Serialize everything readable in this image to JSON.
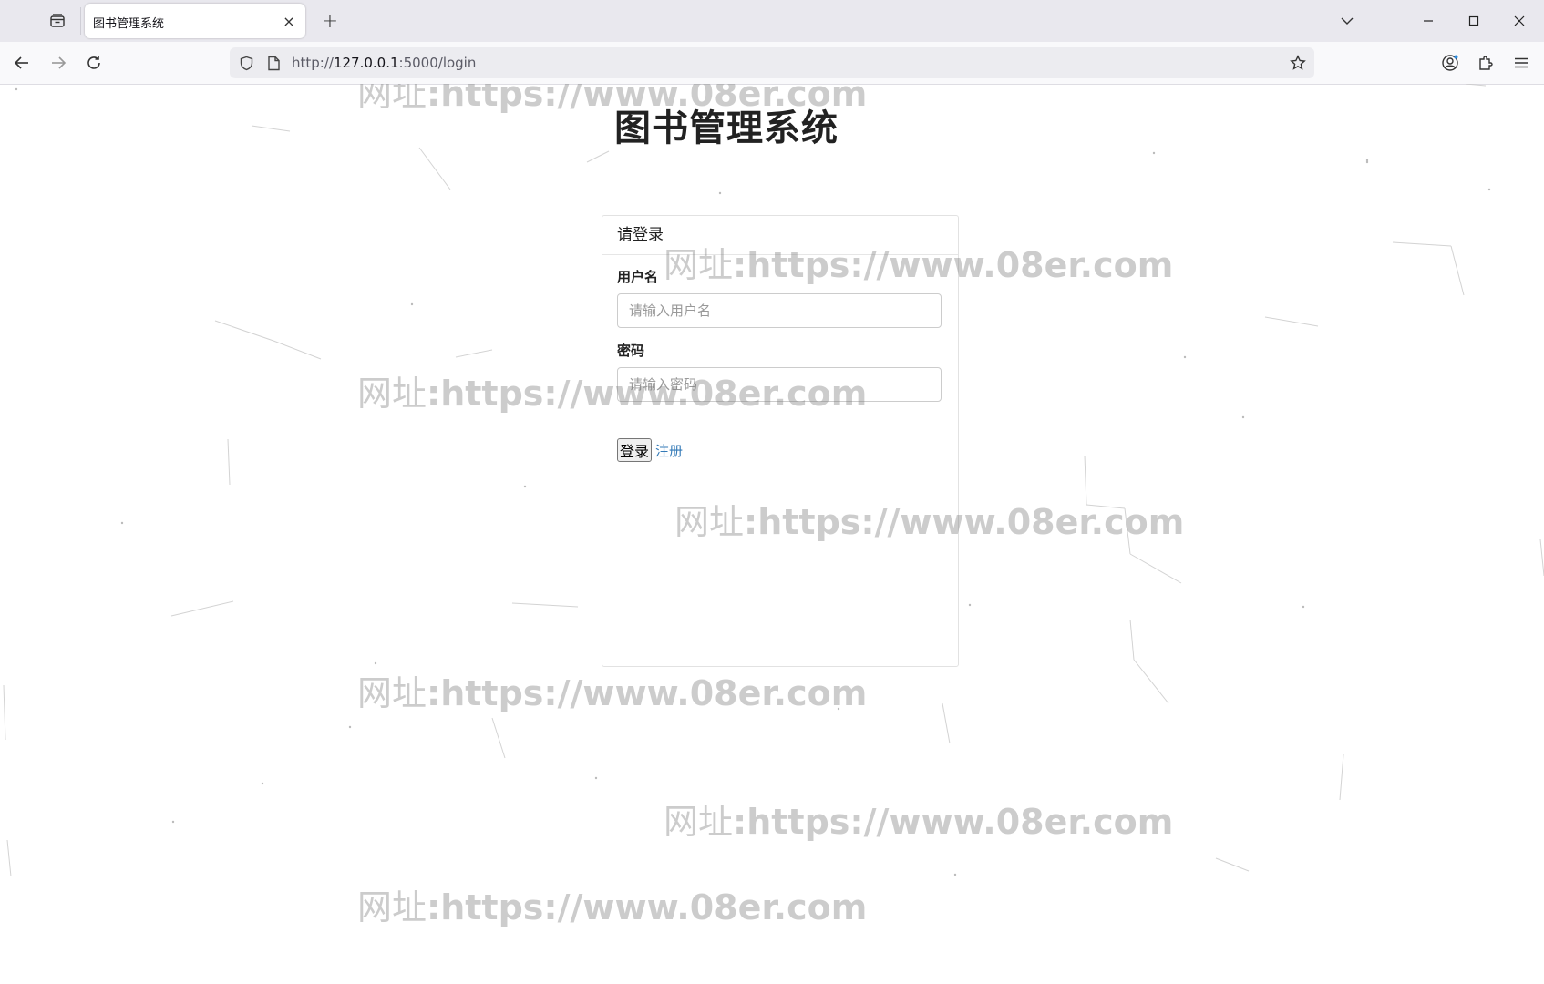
{
  "browser": {
    "tab_title": "图书管理系统",
    "tab_close": "×",
    "new_tab": "+",
    "url_scheme": "http://",
    "url_host": "127.0.0.1",
    "url_rest": ":5000/login"
  },
  "page": {
    "title": "图书管理系统",
    "panel_heading": "请登录",
    "username_label": "用户名",
    "username_placeholder": "请输入用户名",
    "password_label": "密码",
    "password_placeholder": "请输入密码",
    "login_button": "登录",
    "register_link": "注册"
  },
  "watermark": {
    "cn": "网址",
    "url": ":https://www.08er.com"
  }
}
